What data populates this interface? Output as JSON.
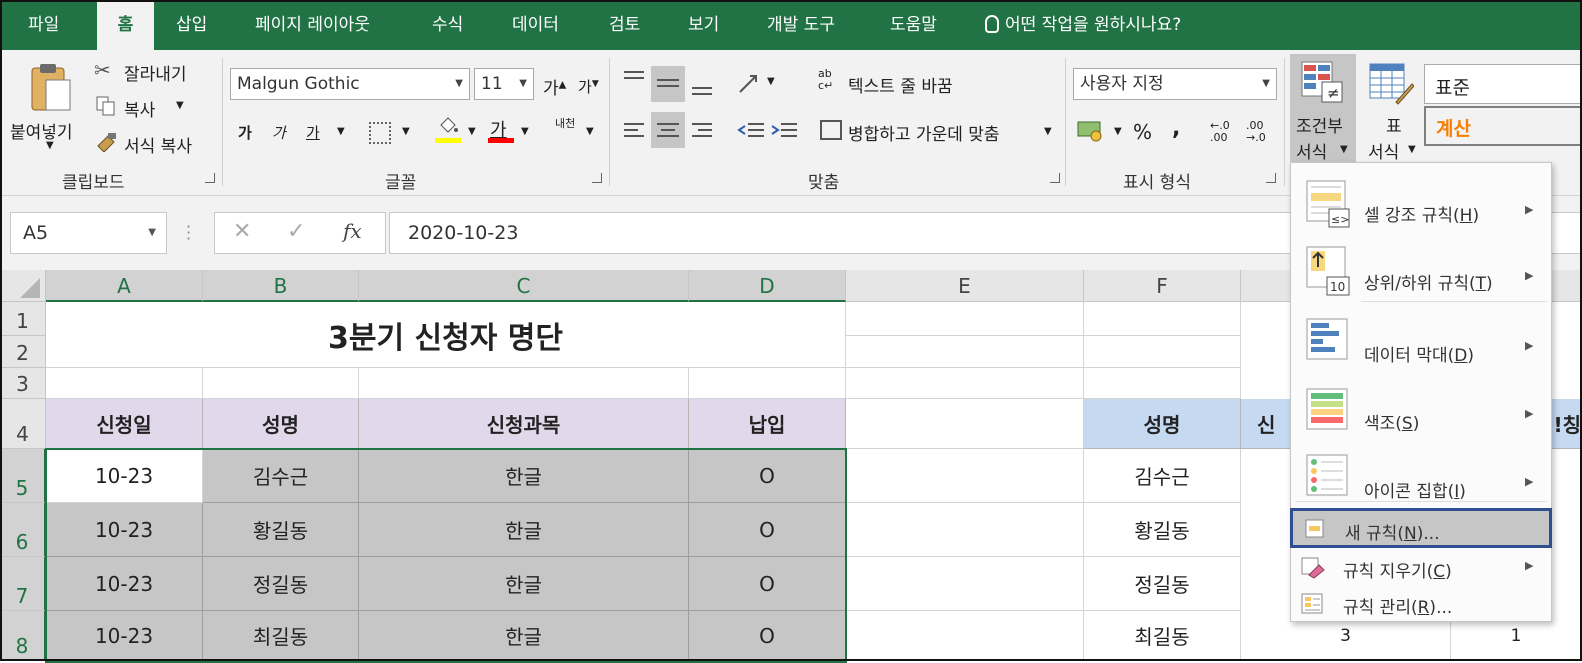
{
  "menubar": {
    "tabs": [
      "파일",
      "홈",
      "삽입",
      "페이지 레이아웃",
      "수식",
      "데이터",
      "검토",
      "보기",
      "개발 도구",
      "도움말"
    ],
    "active": "홈",
    "tellme": "어떤 작업을 원하시나요?"
  },
  "ribbon": {
    "clipboard": {
      "paste": "붙여넣기",
      "cut": "잘라내기",
      "copy": "복사",
      "format_painter": "서식 복사",
      "group": "클립보드"
    },
    "font": {
      "name": "Malgun Gothic",
      "size": "11",
      "grow": "가",
      "shrink": "가",
      "bold": "가",
      "italic": "가",
      "underline": "가",
      "font_color_glyph": "가",
      "phonetic": "내천",
      "group": "글꼴"
    },
    "alignment": {
      "wrap": "텍스트 줄 바꿈",
      "merge": "병합하고 가운데 맞춤",
      "group": "맞춤"
    },
    "number": {
      "format": "사용자 지정",
      "percent": "%",
      "comma": ",",
      "group": "표시 형식"
    },
    "styles": {
      "conditional_line1": "조건부",
      "conditional_line2": "서식",
      "table_line1": "표",
      "table_line2": "서식",
      "style_normal": "표준",
      "style_calc": "계산"
    },
    "colors": {
      "accent": "#217346",
      "calc_text": "#fa7d00",
      "highlight_yellow": "#ffff00",
      "font_red": "#ff0000"
    }
  },
  "formula": {
    "namebox": "A5",
    "value": "2020-10-23"
  },
  "grid": {
    "columns": [
      "A",
      "B",
      "C",
      "D",
      "E",
      "F"
    ],
    "rows": [
      "1",
      "2",
      "3",
      "4",
      "5",
      "6",
      "7",
      "8"
    ],
    "title": "3분기 신청자 명단",
    "headers": [
      "신청일",
      "성명",
      "신청과목",
      "납입"
    ],
    "data": [
      [
        "10-23",
        "김수근",
        "한글",
        "O"
      ],
      [
        "10-23",
        "황길동",
        "한글",
        "O"
      ],
      [
        "10-23",
        "정길동",
        "한글",
        "O"
      ],
      [
        "10-23",
        "최길동",
        "한글",
        "O"
      ]
    ],
    "f_header": "성명",
    "g_header_partial": "신",
    "i_header_partial": "!칭",
    "f_names": [
      "김수근",
      "황길동",
      "정길동",
      "최길동"
    ],
    "row8_g": "3",
    "row8_i": "1"
  },
  "cf_menu": {
    "items": [
      {
        "text": "셀 강조 규칙",
        "key": "H"
      },
      {
        "text": "상위/하위 규칙",
        "key": "T"
      },
      {
        "text": "데이터 막대",
        "key": "D"
      },
      {
        "text": "색조",
        "key": "S"
      },
      {
        "text": "아이콘 집합",
        "key": "I"
      },
      {
        "text": "새 규칙",
        "key": "N",
        "suffix": "..."
      },
      {
        "text": "규칙 지우기",
        "key": "C"
      },
      {
        "text": "규칙 관리",
        "key": "R",
        "suffix": "..."
      }
    ],
    "icon_10": "10"
  }
}
